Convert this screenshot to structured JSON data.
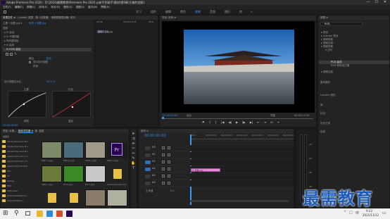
{
  "window": {
    "title": "Adobe Premiere Pro 2020 - D:\\2020\\最需教育\\Premiere Pro 2020 从新手到高手\\素材\\第6章\\大美的宫殿1",
    "controls": [
      "—",
      "☐",
      "✕"
    ]
  },
  "menu": [
    "文件(F)",
    "编辑(E)",
    "剪辑(C)",
    "序列(S)",
    "标记(M)",
    "图形(G)",
    "视图(V)",
    "窗口(W)",
    "帮助(H)"
  ],
  "workspaces": [
    "学习",
    "组件",
    "编辑",
    "颜色",
    "效果",
    "音频",
    "图形",
    "库",
    "»"
  ],
  "workspace_active": "效果",
  "effect_controls": {
    "tabs": [
      "效果控件 ≡",
      "Lumetri 范围",
      "源: (无剪辑)",
      "音频剪辑混合器: 序列"
    ],
    "clip_label": "主要 * 宫殿.jpg ▾",
    "clip_value": "序列 * 宫殿.jpg",
    "section_label": "视频",
    "rows": [
      "▸ fx 运动",
      "▸ fx 不透明度",
      "▸ 时间重映射",
      "▾ fx 曲线",
      "fx RGB 曲线"
    ],
    "output_label": "输出",
    "output_value": "复合",
    "checkbox1": "显示拆分视图",
    "checkbox2": "布局",
    "channel_label": "拆分视图百分比",
    "channel_value": "50.0 %",
    "master_label": "主要",
    "red_label": "红色",
    "green_label": "绿色",
    "blue_label": "蓝色",
    "timecode": "00:00:00:00",
    "ruler_start": "00:00",
    "ruler_mid": "00:00:14:23",
    "ruler_end": "00:0"
  },
  "program_monitor": {
    "tab": "节目: 序列 ≡",
    "timecode_left": "00:00:00:00",
    "fit": "适合",
    "scale": "完整",
    "timecode_right": "00:00:15:09",
    "buttons": [
      "⚑",
      "{",
      "}",
      "|◀",
      "◀|",
      "▶",
      "|▶",
      "▶|",
      "⇤",
      "⇥",
      "⊡",
      "+"
    ]
  },
  "effects_panel": {
    "header": "效果 ≡",
    "search_value": "RGB",
    "tree": [
      {
        "label": "▸ 预设",
        "level": 0
      },
      {
        "label": "▸ Lumetri 预设",
        "level": 0
      },
      {
        "label": "▸ 音频效果",
        "level": 0
      },
      {
        "label": "▸ 音频过渡",
        "level": 0
      },
      {
        "label": "▾ 视频效果",
        "level": 0
      },
      {
        "label": "▾ 过时",
        "level": 1
      },
      {
        "label": "RGB 曲线",
        "level": 2
      },
      {
        "label": "RGB 颜色校正器",
        "level": 2
      },
      {
        "label": "▸ 视频过渡",
        "level": 0
      }
    ],
    "selected_index": 6,
    "side_panels": [
      "基本图形",
      "Lumetri 颜色",
      "库",
      "标记",
      "历史记录",
      "信息"
    ]
  },
  "project": {
    "tabs": [
      "项目: 大美...",
      "媒体浏览器 ≡",
      "库",
      "信息"
    ],
    "tree_header": "收藏夹",
    "folders": [
      "Adobe Premiere Pro",
      "Adobe Premiere Pro",
      "Adobe Premiere Pro",
      "apache-tomcat-7.0.",
      "apache-tomcat-7.0.",
      "apache-tomcat-8.5.",
      "ATA",
      "CF",
      "Debug",
      "HBX",
      "MyEclipse",
      "PhotoDatePlatform",
      "PicturePlatform"
    ],
    "files": [
      {
        "name": "0007_1.jpg",
        "color": "#7c8a6a"
      },
      {
        "name": "0001_1.jpg",
        "color": "#4a6b7a"
      },
      {
        "name": "0002_1.jpg",
        "color": "#a09a8a"
      },
      {
        "name": "0004_1.jpg",
        "color": "#5a4080"
      },
      {
        "name": "0006_1.jpg",
        "color": "#6a7a3a"
      },
      {
        "name": "fbc12.jpg",
        "color": "#3a8a2a"
      },
      {
        "name": "fbc11.jpg",
        "color": "#c8c8c8"
      },
      {
        "name": "Adobe Premiere Pro",
        "color": "#e8c046"
      },
      {
        "name": "Adobe Premiere Pro",
        "color": "#e8c046"
      },
      {
        "name": "Adobe Premiere Pro",
        "color": "#e8c046"
      },
      {
        "name": "宫殿.jpg",
        "color": "#8a7a6a"
      },
      {
        "name": "合照.jpg",
        "color": "#b0b0a0"
      }
    ],
    "pr_label": "Pr",
    "file_tail": "磁贴"
  },
  "timeline": {
    "tab": "序列 ≡",
    "timecode": "00:00:00:00",
    "ruler": [
      "00:00",
      "00:00:04:23",
      "00:00:09:23",
      "00:00:14:23",
      "00:00:19:23",
      "00:00:24:23",
      "00:00:29:23"
    ],
    "tracks": [
      {
        "name": "V3",
        "kind": "video"
      },
      {
        "name": "V2",
        "kind": "video"
      },
      {
        "name": "V1",
        "kind": "video"
      },
      {
        "name": "A1",
        "kind": "audio"
      },
      {
        "name": "A2",
        "kind": "audio"
      },
      {
        "name": "A3",
        "kind": "audio"
      }
    ],
    "master": "主声道",
    "master_value": "0.0",
    "clip_label": "fx 宫殿.jpg",
    "clip_color": "#e88ad8",
    "meter_labels": [
      "-12",
      "-24",
      "-36",
      "-48",
      "dB"
    ]
  },
  "overlay": {
    "watermark": "最需教育"
  },
  "taskbar": {
    "start": "⊞",
    "search": "⚲",
    "apps": [
      {
        "name": "file-explorer",
        "color": "#e8b72a"
      },
      {
        "name": "edge",
        "color": "#2a8ad8"
      },
      {
        "name": "app3",
        "color": "#d84a2a"
      },
      {
        "name": "premiere",
        "color": "#2a0050"
      }
    ],
    "time": "9:22",
    "date": "2021/11/12",
    "tray": [
      "^",
      "□",
      "中"
    ],
    "notify": "▭"
  }
}
